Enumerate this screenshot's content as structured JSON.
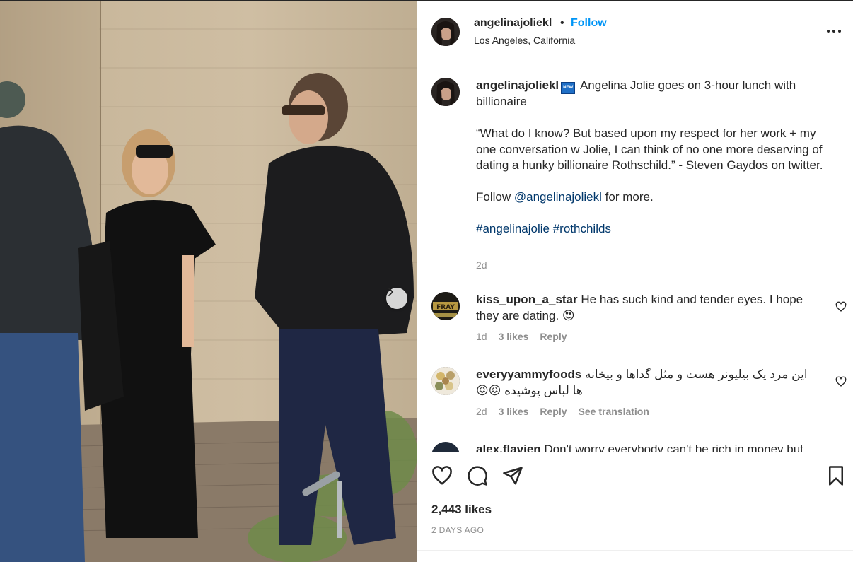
{
  "post": {
    "username": "angelinajoliekl",
    "follow_label": "Follow",
    "separator": "•",
    "location": "Los Angeles, California"
  },
  "caption": {
    "username": "angelinajoliekl",
    "badge_text": "NEW",
    "line1": "Angelina Jolie goes on 3-hour lunch with billionaire",
    "quote": "“What do I know? But based upon my respect for her work + my one conversation w Jolie, I can think of no one more deserving of dating a hunky billionaire Rothschild.” - Steven Gaydos on twitter.",
    "follow_prefix": "Follow ",
    "follow_mention": "@angelinajoliekl",
    "follow_suffix": " for more.",
    "hashtags": [
      "#angelinajolie",
      "#rothchilds"
    ],
    "time": "2d"
  },
  "comments": [
    {
      "username": "kiss_upon_a_star",
      "text": "He has such kind and tender eyes. I hope they are dating. 😍",
      "time": "1d",
      "likes": "3 likes",
      "reply": "Reply",
      "avatar_text": "FRAY"
    },
    {
      "username": "everyyammyfoods",
      "text": "این مرد یک بیلیونر هست و مثل گداها و بیخانه ها لباس پوشیده 😖😖",
      "time": "2d",
      "likes": "3 likes",
      "reply": "Reply",
      "translate": "See translation"
    },
    {
      "username": "alex.flavien",
      "text": "Don't worry everybody can't be rich in money but"
    }
  ],
  "footer": {
    "likes": "2,443 likes",
    "date": "2 DAYS AGO"
  },
  "colors": {
    "accent": "#0095f6",
    "link": "#00376b",
    "muted": "#8e8e8e",
    "text": "#262626"
  },
  "icons": [
    "more-icon",
    "heart-icon",
    "comment-icon",
    "share-icon",
    "bookmark-icon",
    "chevron-right-icon"
  ]
}
